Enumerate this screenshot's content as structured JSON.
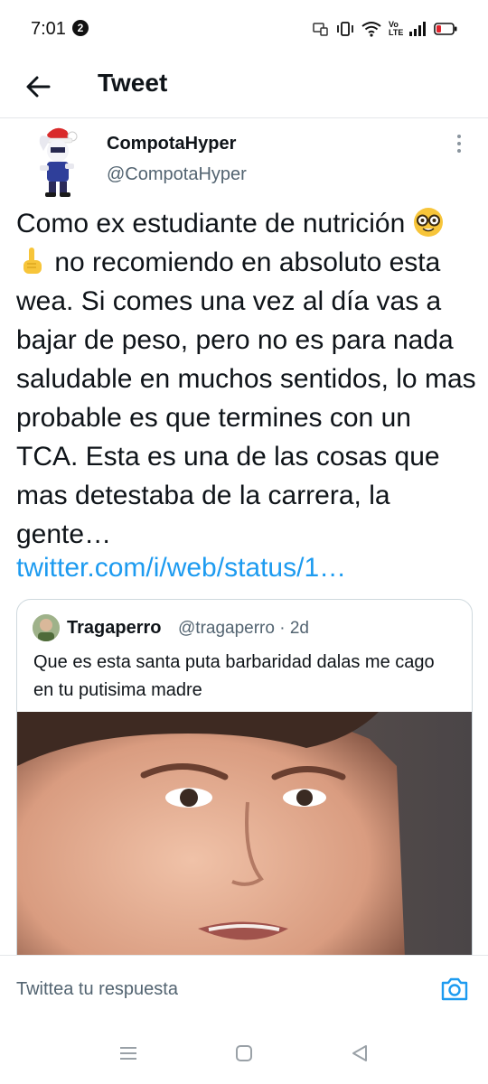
{
  "status_bar": {
    "time": "7:01",
    "notification_count": "2",
    "network_label": "Vo LTE"
  },
  "header": {
    "title": "Tweet"
  },
  "tweet": {
    "author_name": "CompotaHyper",
    "author_handle": "@CompotaHyper",
    "text_part1": "Como ex estudiante de nutrición ",
    "emoji1": "nerd-face-emoji",
    "emoji2": "index-pointing-up-emoji",
    "text_part2": " no recomiendo en absoluto esta wea. Si comes una vez al día vas a bajar de peso, pero no es para nada saludable en muchos sentidos, lo mas probable es que termines con un TCA. Esta es una de las cosas que mas detestaba de la carrera, la gente…",
    "link": "twitter.com/i/web/status/1…"
  },
  "quoted_tweet": {
    "author_name": "Tragaperro",
    "author_handle": "@tragaperro",
    "separator": "·",
    "time": "2d",
    "text": "Que es esta santa puta barbaridad dalas me cago en tu putisima madre"
  },
  "reply": {
    "placeholder": "Twittea tu respuesta"
  },
  "icons": {
    "back": "arrow-left-icon",
    "more": "vertical-ellipsis-icon",
    "camera": "camera-icon",
    "nav": [
      "menu-icon",
      "home-square-icon",
      "back-triangle-icon"
    ]
  },
  "colors": {
    "link": "#1d9bf0",
    "secondary_text": "#536471",
    "primary_text": "#0f1419",
    "border": "#cfd9de"
  }
}
